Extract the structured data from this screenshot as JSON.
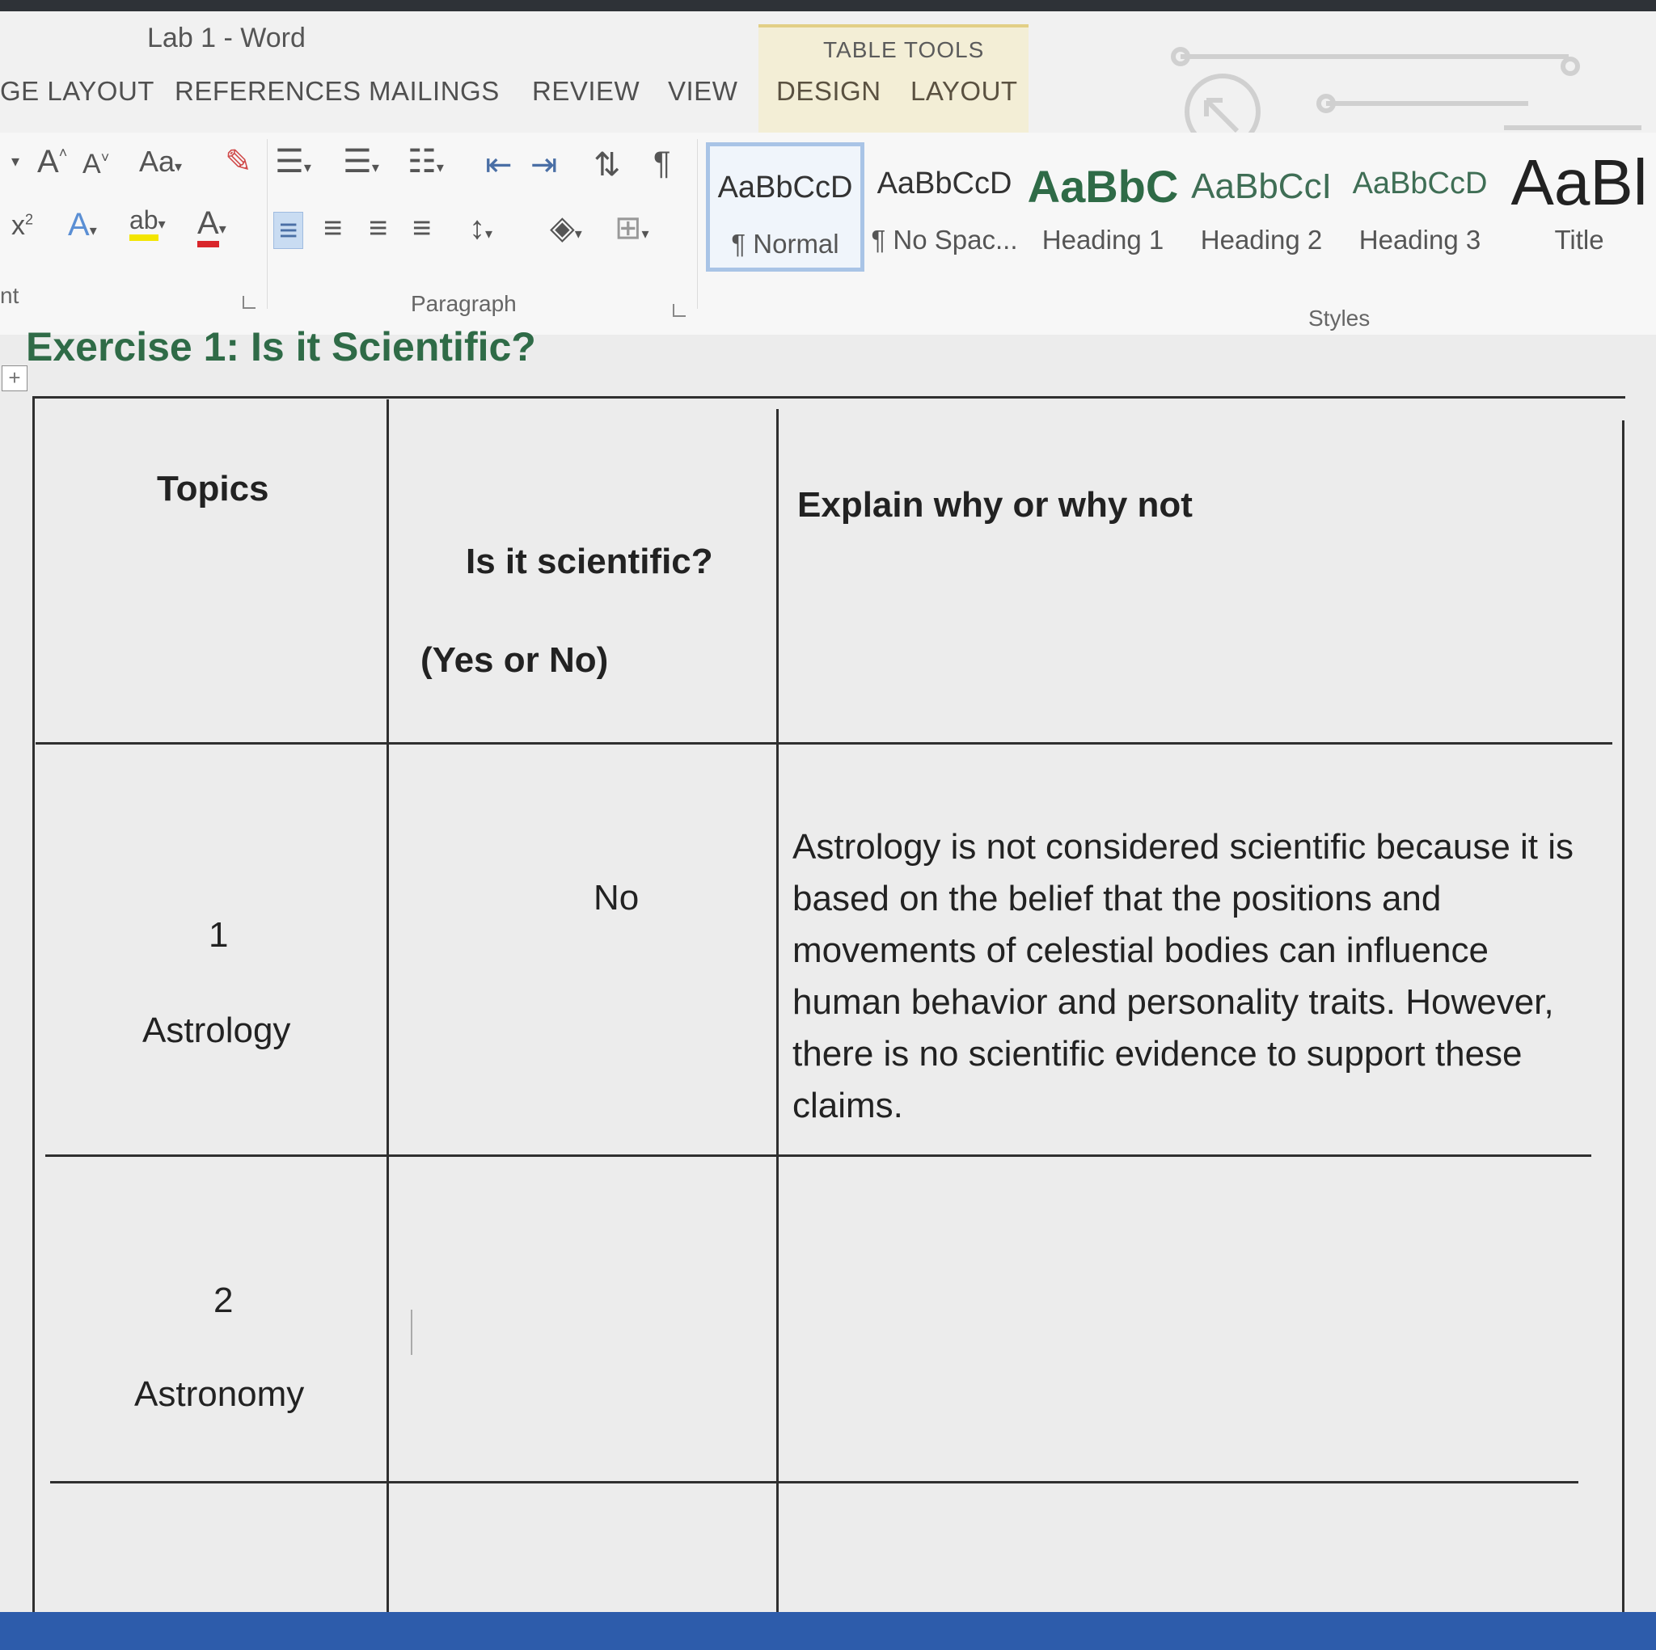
{
  "window": {
    "title": "Lab 1 - Word"
  },
  "ribbon_tabs": [
    "GE LAYOUT",
    "REFERENCES",
    "MAILINGS",
    "REVIEW",
    "VIEW"
  ],
  "table_tools": {
    "label": "TABLE TOOLS",
    "tabs": [
      "DESIGN",
      "LAYOUT"
    ]
  },
  "font_group": {
    "label": "nt",
    "grow_font": "A",
    "shrink_font": "A",
    "change_case": "Aa",
    "superscript": "x",
    "text_effects": "A",
    "highlight": "ab",
    "font_color": "A"
  },
  "paragraph_group": {
    "label": "Paragraph",
    "show_marks": "¶"
  },
  "styles_group": {
    "label": "Styles",
    "items": [
      {
        "sample": "AaBbCcD",
        "name": "¶ Normal"
      },
      {
        "sample": "AaBbCcD",
        "name": "¶ No Spac..."
      },
      {
        "sample": "AaBbC",
        "name": "Heading 1"
      },
      {
        "sample": "AaBbCcI",
        "name": "Heading 2"
      },
      {
        "sample": "AaBbCcD",
        "name": "Heading 3"
      },
      {
        "sample": "AaBl",
        "name": "Title"
      }
    ]
  },
  "document": {
    "heading": "Exercise 1: Is it Scientific?",
    "table": {
      "headers": {
        "topics": "Topics",
        "scientific_line1": "Is it scientific?",
        "scientific_line2": "(Yes or No)",
        "explain": "Explain why or why not"
      },
      "rows": [
        {
          "number": "1",
          "topic": "Astrology",
          "answer": "No",
          "explanation": "Astrology is not considered scientific because it is based on the belief that the positions and movements of celestial bodies can influence human behavior and personality traits. However, there is no scientific evidence to support these claims."
        },
        {
          "number": "2",
          "topic": "Astronomy",
          "answer": "",
          "explanation": ""
        }
      ]
    }
  },
  "colors": {
    "heading_green": "#2f6b47",
    "taskbar_blue": "#2d5cab",
    "table_tools_bg": "#f3eed6"
  }
}
